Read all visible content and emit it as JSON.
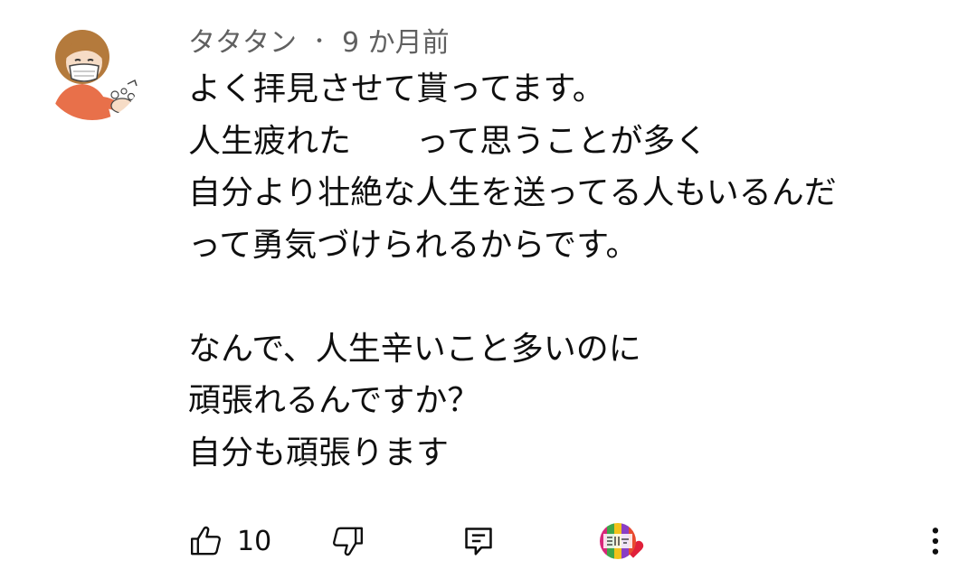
{
  "comment": {
    "author": "タタタン",
    "separator": "・",
    "timestamp": "9 か月前",
    "lines": [
      "よく拝見させて貰ってます。",
      "人生疲れた　　って思うことが多く",
      "自分より壮絶な人生を送ってる人もいるんだ",
      "って勇気づけられるからです。",
      "",
      "なんで、人生辛いこと多いのに",
      "頑張れるんですか？",
      "自分も頑張ります"
    ],
    "like_count": "10"
  },
  "icons": {
    "like": "thumbs-up-icon",
    "dislike": "thumbs-down-icon",
    "reply": "reply-comment-icon",
    "hearted": "creator-heart-icon",
    "more": "more-vertical-icon"
  },
  "colors": {
    "text": "#0f0f0f",
    "meta": "#606060",
    "heart": "#e0203a",
    "avatar_shirt": "#e8704a"
  }
}
